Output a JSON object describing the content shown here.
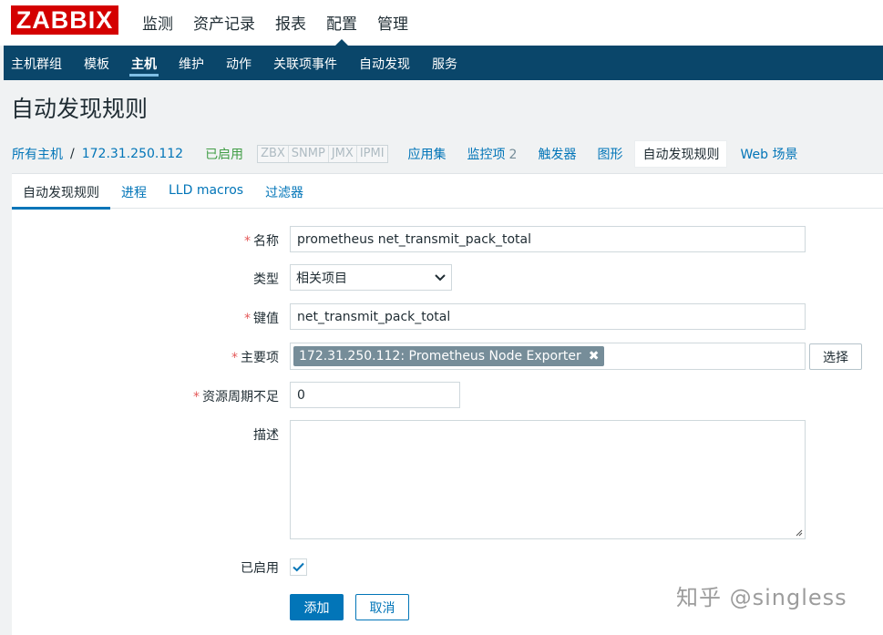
{
  "header": {
    "logo": "ZABBIX",
    "menu": [
      "监测",
      "资产记录",
      "报表",
      "配置",
      "管理"
    ],
    "active_menu": 3
  },
  "submenu": {
    "items": [
      "主机群组",
      "模板",
      "主机",
      "维护",
      "动作",
      "关联项事件",
      "自动发现",
      "服务"
    ],
    "active": 2
  },
  "page_title": "自动发现规则",
  "hostnav": {
    "all_hosts": "所有主机",
    "separator": "/",
    "host": "172.31.250.112",
    "status": "已启用",
    "availability": [
      "ZBX",
      "SNMP",
      "JMX",
      "IPMI"
    ],
    "links": {
      "applications": "应用集",
      "items": "监控项",
      "items_count": "2",
      "triggers": "触发器",
      "graphs": "图形",
      "discovery": "自动发现规则",
      "web": "Web 场景"
    }
  },
  "tabs": [
    "自动发现规则",
    "进程",
    "LLD macros",
    "过滤器"
  ],
  "form": {
    "required_mark": "*",
    "name_label": "名称",
    "name_value": "prometheus net_transmit_pack_total",
    "type_label": "类型",
    "type_value": "相关项目",
    "key_label": "键值",
    "key_value": "net_transmit_pack_total",
    "master_label": "主要项",
    "master_value": "172.31.250.112: Prometheus Node Exporter",
    "select_button": "选择",
    "lifetime_label": "资源周期不足",
    "lifetime_value": "0",
    "desc_label": "描述",
    "desc_value": "",
    "enabled_label": "已启用",
    "enabled": true,
    "add_button": "添加",
    "cancel_button": "取消"
  },
  "watermark": "知乎 @singless",
  "colors": {
    "brand_red": "#d40000",
    "nav_dark": "#0a466a",
    "link_blue": "#0275b8",
    "enabled_green": "#429e47",
    "required_red": "#e45959"
  }
}
